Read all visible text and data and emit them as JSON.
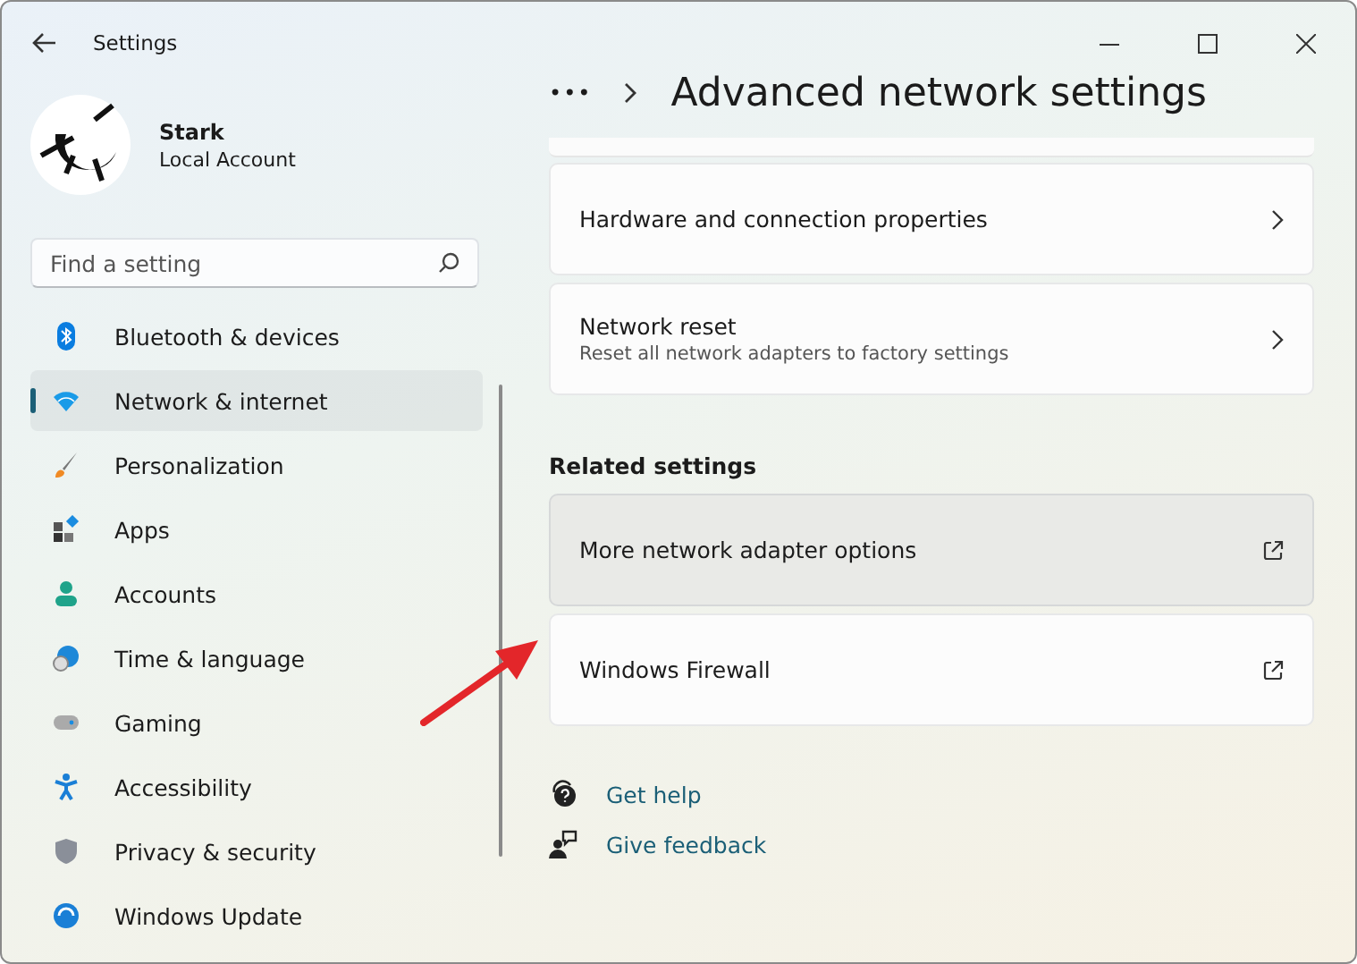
{
  "window": {
    "title": "Settings"
  },
  "account": {
    "name": "Stark",
    "type": "Local Account"
  },
  "search": {
    "placeholder": "Find a setting"
  },
  "sidebar": {
    "items": [
      {
        "label": "Bluetooth & devices",
        "selected": false
      },
      {
        "label": "Network & internet",
        "selected": true
      },
      {
        "label": "Personalization",
        "selected": false
      },
      {
        "label": "Apps",
        "selected": false
      },
      {
        "label": "Accounts",
        "selected": false
      },
      {
        "label": "Time & language",
        "selected": false
      },
      {
        "label": "Gaming",
        "selected": false
      },
      {
        "label": "Accessibility",
        "selected": false
      },
      {
        "label": "Privacy & security",
        "selected": false
      },
      {
        "label": "Windows Update",
        "selected": false
      }
    ]
  },
  "header": {
    "breadcrumb_more": "•••",
    "title": "Advanced network settings"
  },
  "cards": [
    {
      "kind": "nav",
      "title": "Hardware and connection properties",
      "hovered": false
    },
    {
      "kind": "nav",
      "title": "Network reset",
      "description": "Reset all network adapters to factory settings",
      "hovered": false
    }
  ],
  "related": {
    "heading": "Related settings",
    "cards": [
      {
        "kind": "external",
        "title": "More network adapter options",
        "hovered": true
      },
      {
        "kind": "external",
        "title": "Windows Firewall",
        "hovered": false
      }
    ]
  },
  "links": [
    {
      "kind": "help",
      "label": "Get help"
    },
    {
      "kind": "feedback",
      "label": "Give feedback"
    }
  ]
}
